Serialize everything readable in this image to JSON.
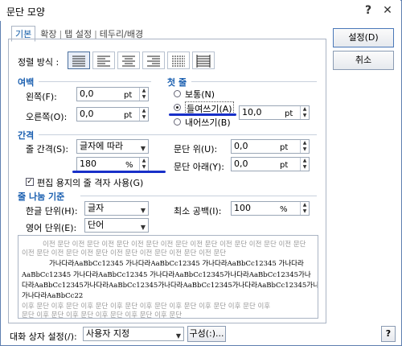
{
  "window": {
    "title": "문단 모양",
    "help_glyph": "?",
    "close_glyph": "✕"
  },
  "tabs": [
    "기본",
    "확장",
    "탭 설정",
    "테두리/배경"
  ],
  "buttons": {
    "ok": "설정(D)",
    "cancel": "취소",
    "config": "구성(:)...",
    "help": "?"
  },
  "align": {
    "label": "정렬 방식 :",
    "options": [
      "justify",
      "left",
      "center",
      "right",
      "distribute",
      "divide"
    ],
    "selected": 0
  },
  "margin": {
    "title": "여백",
    "left_label": "왼쪽(F):",
    "left_value": "0,0",
    "left_unit": "pt",
    "right_label": "오른쪽(O):",
    "right_value": "0,0",
    "right_unit": "pt"
  },
  "first_line": {
    "title": "첫 줄",
    "options": [
      "보통(N)",
      "들여쓰기(A)",
      "내어쓰기(B)"
    ],
    "selected": 1,
    "value": "10,0",
    "unit": "pt"
  },
  "spacing": {
    "title": "간격",
    "line_label": "줄 간격(S):",
    "line_type": "글자에 따라",
    "line_value": "180",
    "line_unit": "%",
    "above_label": "문단 위(U):",
    "above_value": "0,0",
    "above_unit": "pt",
    "below_label": "문단 아래(Y):",
    "below_value": "0,0",
    "below_unit": "pt",
    "grid_label": "편집 용지의 줄 격자 사용(G)",
    "grid_checked": true
  },
  "line_break": {
    "title": "줄 나눔 기준",
    "korean_label": "한글 단위(H):",
    "korean_value": "글자",
    "english_label": "영어 단위(E):",
    "english_value": "단어",
    "min_space_label": "최소 공백(I):",
    "min_space_value": "100",
    "min_space_unit": "%"
  },
  "preview": {
    "before": [
      "이전 문단 이전 문단 이전 문단 이전 문단 이전 문단 이전 문단 이전 문단 이전 문단 이전 문단",
      "이전 문단 이전 문단 이전 문단 이전 문단 이전 문단 이전 문단 이전 문단"
    ],
    "body": [
      "가나다라AaBbCc12345   가나다라AaBbCc12345   가나다라AaBbCc12345   가나다라",
      "AaBbCc12345   가나다라AaBbCc12345   가나다라AaBbCc12345가나다라AaBbCc12345가나",
      "다라AaBbCc12345가나다라AaBbCc12345가나다라AaBbCc12345가나다라AaBbCc12345가나다라",
      "가나다라AaBbCc22"
    ],
    "after": [
      "이후 문단 이후 문단 이후 문단 이후 문단 이후 문단 이후 문단 이후 문단 이후 문단 이후",
      "문단 이후 문단 이후 문단 이후 문단 이후 문단 이후 문단"
    ]
  },
  "footer": {
    "label": "대화 상자 설정(/):",
    "value": "사용자 지정"
  },
  "colors": {
    "accent": "#1a5fb0",
    "annotation": "#1830c8"
  }
}
